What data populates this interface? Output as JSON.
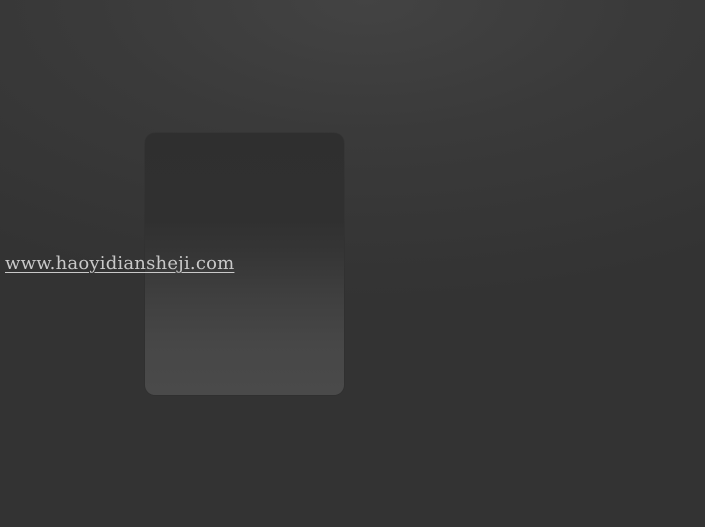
{
  "watermark": {
    "text": "www.haoyidiansheji.com"
  },
  "colors": {
    "background": "#363636",
    "card_top": "#2f2f2f",
    "card_bottom": "#4a4a4a",
    "link_text": "#c9c9c9"
  }
}
